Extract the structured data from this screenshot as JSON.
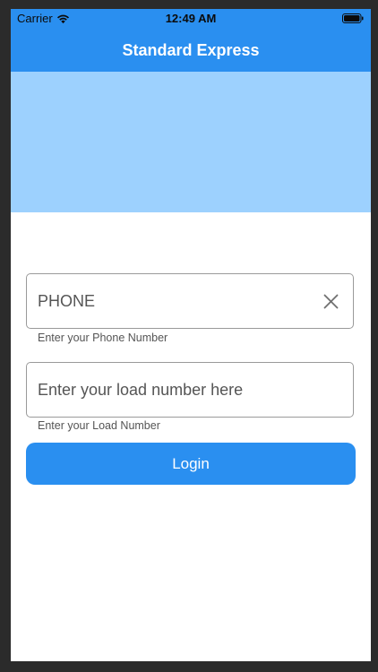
{
  "status_bar": {
    "carrier": "Carrier",
    "time": "12:49 AM",
    "wifi_icon": "wifi-icon",
    "battery_icon": "battery-icon"
  },
  "header": {
    "title": "Standard Express"
  },
  "form": {
    "phone": {
      "placeholder": "PHONE",
      "helper": "Enter your Phone Number",
      "clear_icon": "close-icon"
    },
    "load": {
      "placeholder": "Enter your load number here",
      "helper": "Enter your Load Number"
    },
    "login_label": "Login"
  },
  "colors": {
    "primary": "#2a8ff0",
    "banner": "#9dd1fe",
    "background": "#ffffff",
    "frame": "#2b2b2b"
  }
}
